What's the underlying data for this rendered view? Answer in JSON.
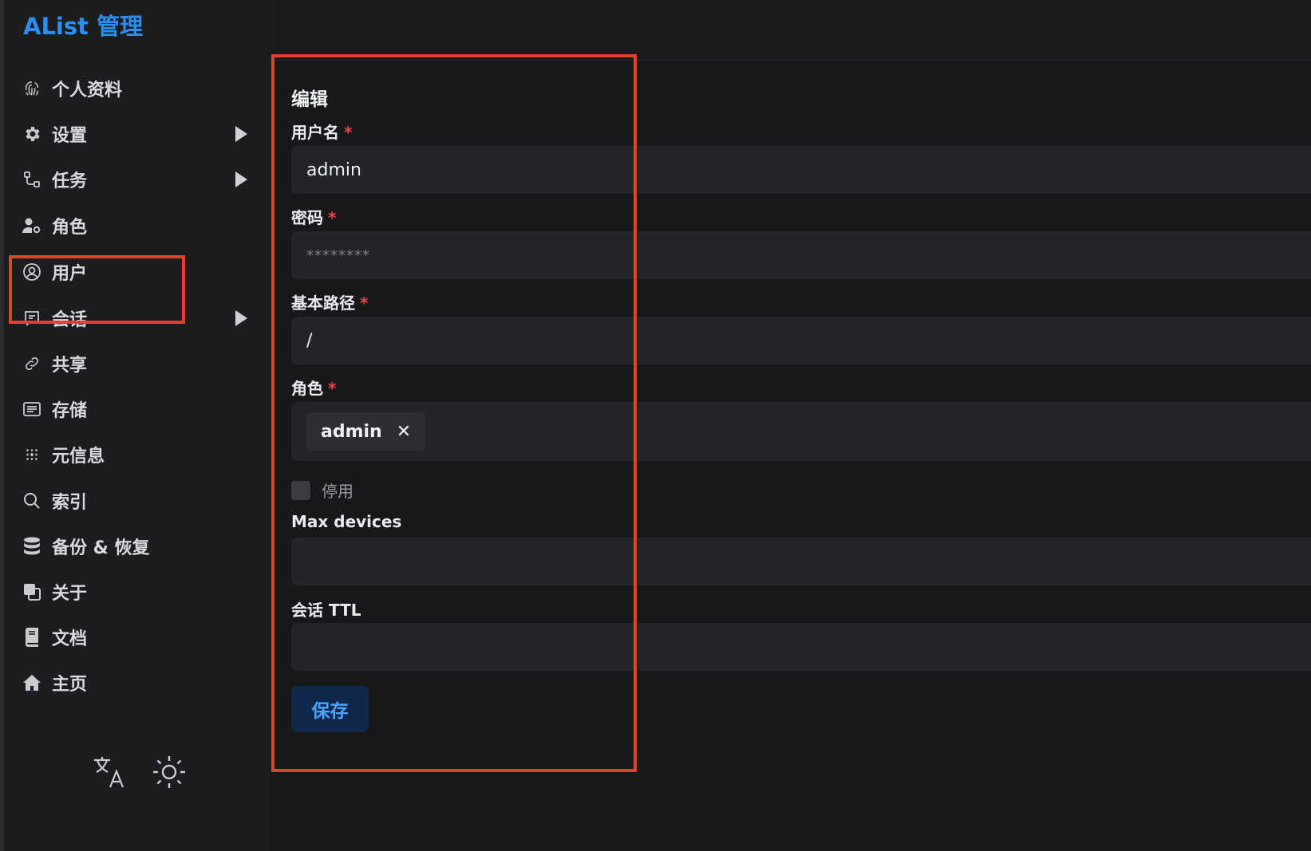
{
  "brand": {
    "title": "AList 管理",
    "color": "#2b8ef3"
  },
  "sidebar": {
    "items": [
      {
        "label": "个人资料",
        "icon": "fingerprint-icon",
        "has_children": false
      },
      {
        "label": "设置",
        "icon": "gear-icon",
        "has_children": true
      },
      {
        "label": "任务",
        "icon": "flow-icon",
        "has_children": true
      },
      {
        "label": "角色",
        "icon": "user-gear-icon",
        "has_children": false
      },
      {
        "label": "用户",
        "icon": "user-circle-icon",
        "has_children": false,
        "selected": true
      },
      {
        "label": "会话",
        "icon": "session-icon",
        "has_children": true
      },
      {
        "label": "共享",
        "icon": "link-icon",
        "has_children": false
      },
      {
        "label": "存储",
        "icon": "storage-icon",
        "has_children": false
      },
      {
        "label": "元信息",
        "icon": "meta-icon",
        "has_children": false
      },
      {
        "label": "索引",
        "icon": "search-icon",
        "has_children": false
      },
      {
        "label": "备份 & 恢复",
        "icon": "database-icon",
        "has_children": false
      },
      {
        "label": "关于",
        "icon": "copy-icon",
        "has_children": false
      },
      {
        "label": "文档",
        "icon": "book-icon",
        "has_children": false
      },
      {
        "label": "主页",
        "icon": "home-icon",
        "has_children": false
      }
    ],
    "tools": [
      {
        "icon": "translate-icon"
      },
      {
        "icon": "sun-icon"
      }
    ]
  },
  "form": {
    "title": "编辑",
    "username": {
      "label": "用户名",
      "required": "*",
      "value": "admin"
    },
    "password": {
      "label": "密码",
      "required": "*",
      "placeholder": "********"
    },
    "base_path": {
      "label": "基本路径",
      "required": "*",
      "value": "/"
    },
    "role": {
      "label": "角色",
      "required": "*",
      "selected_tag": "admin",
      "remove_glyph": "✕"
    },
    "disabled": {
      "label": "停用",
      "checked": false
    },
    "max_devices": {
      "label": "Max devices",
      "value": ""
    },
    "session_ttl": {
      "label": "会话 TTL",
      "value": ""
    },
    "save_label": "保存"
  },
  "colors": {
    "accent": "#4aa3ff",
    "highlight": "#e0432b",
    "required": "#e5484d"
  }
}
